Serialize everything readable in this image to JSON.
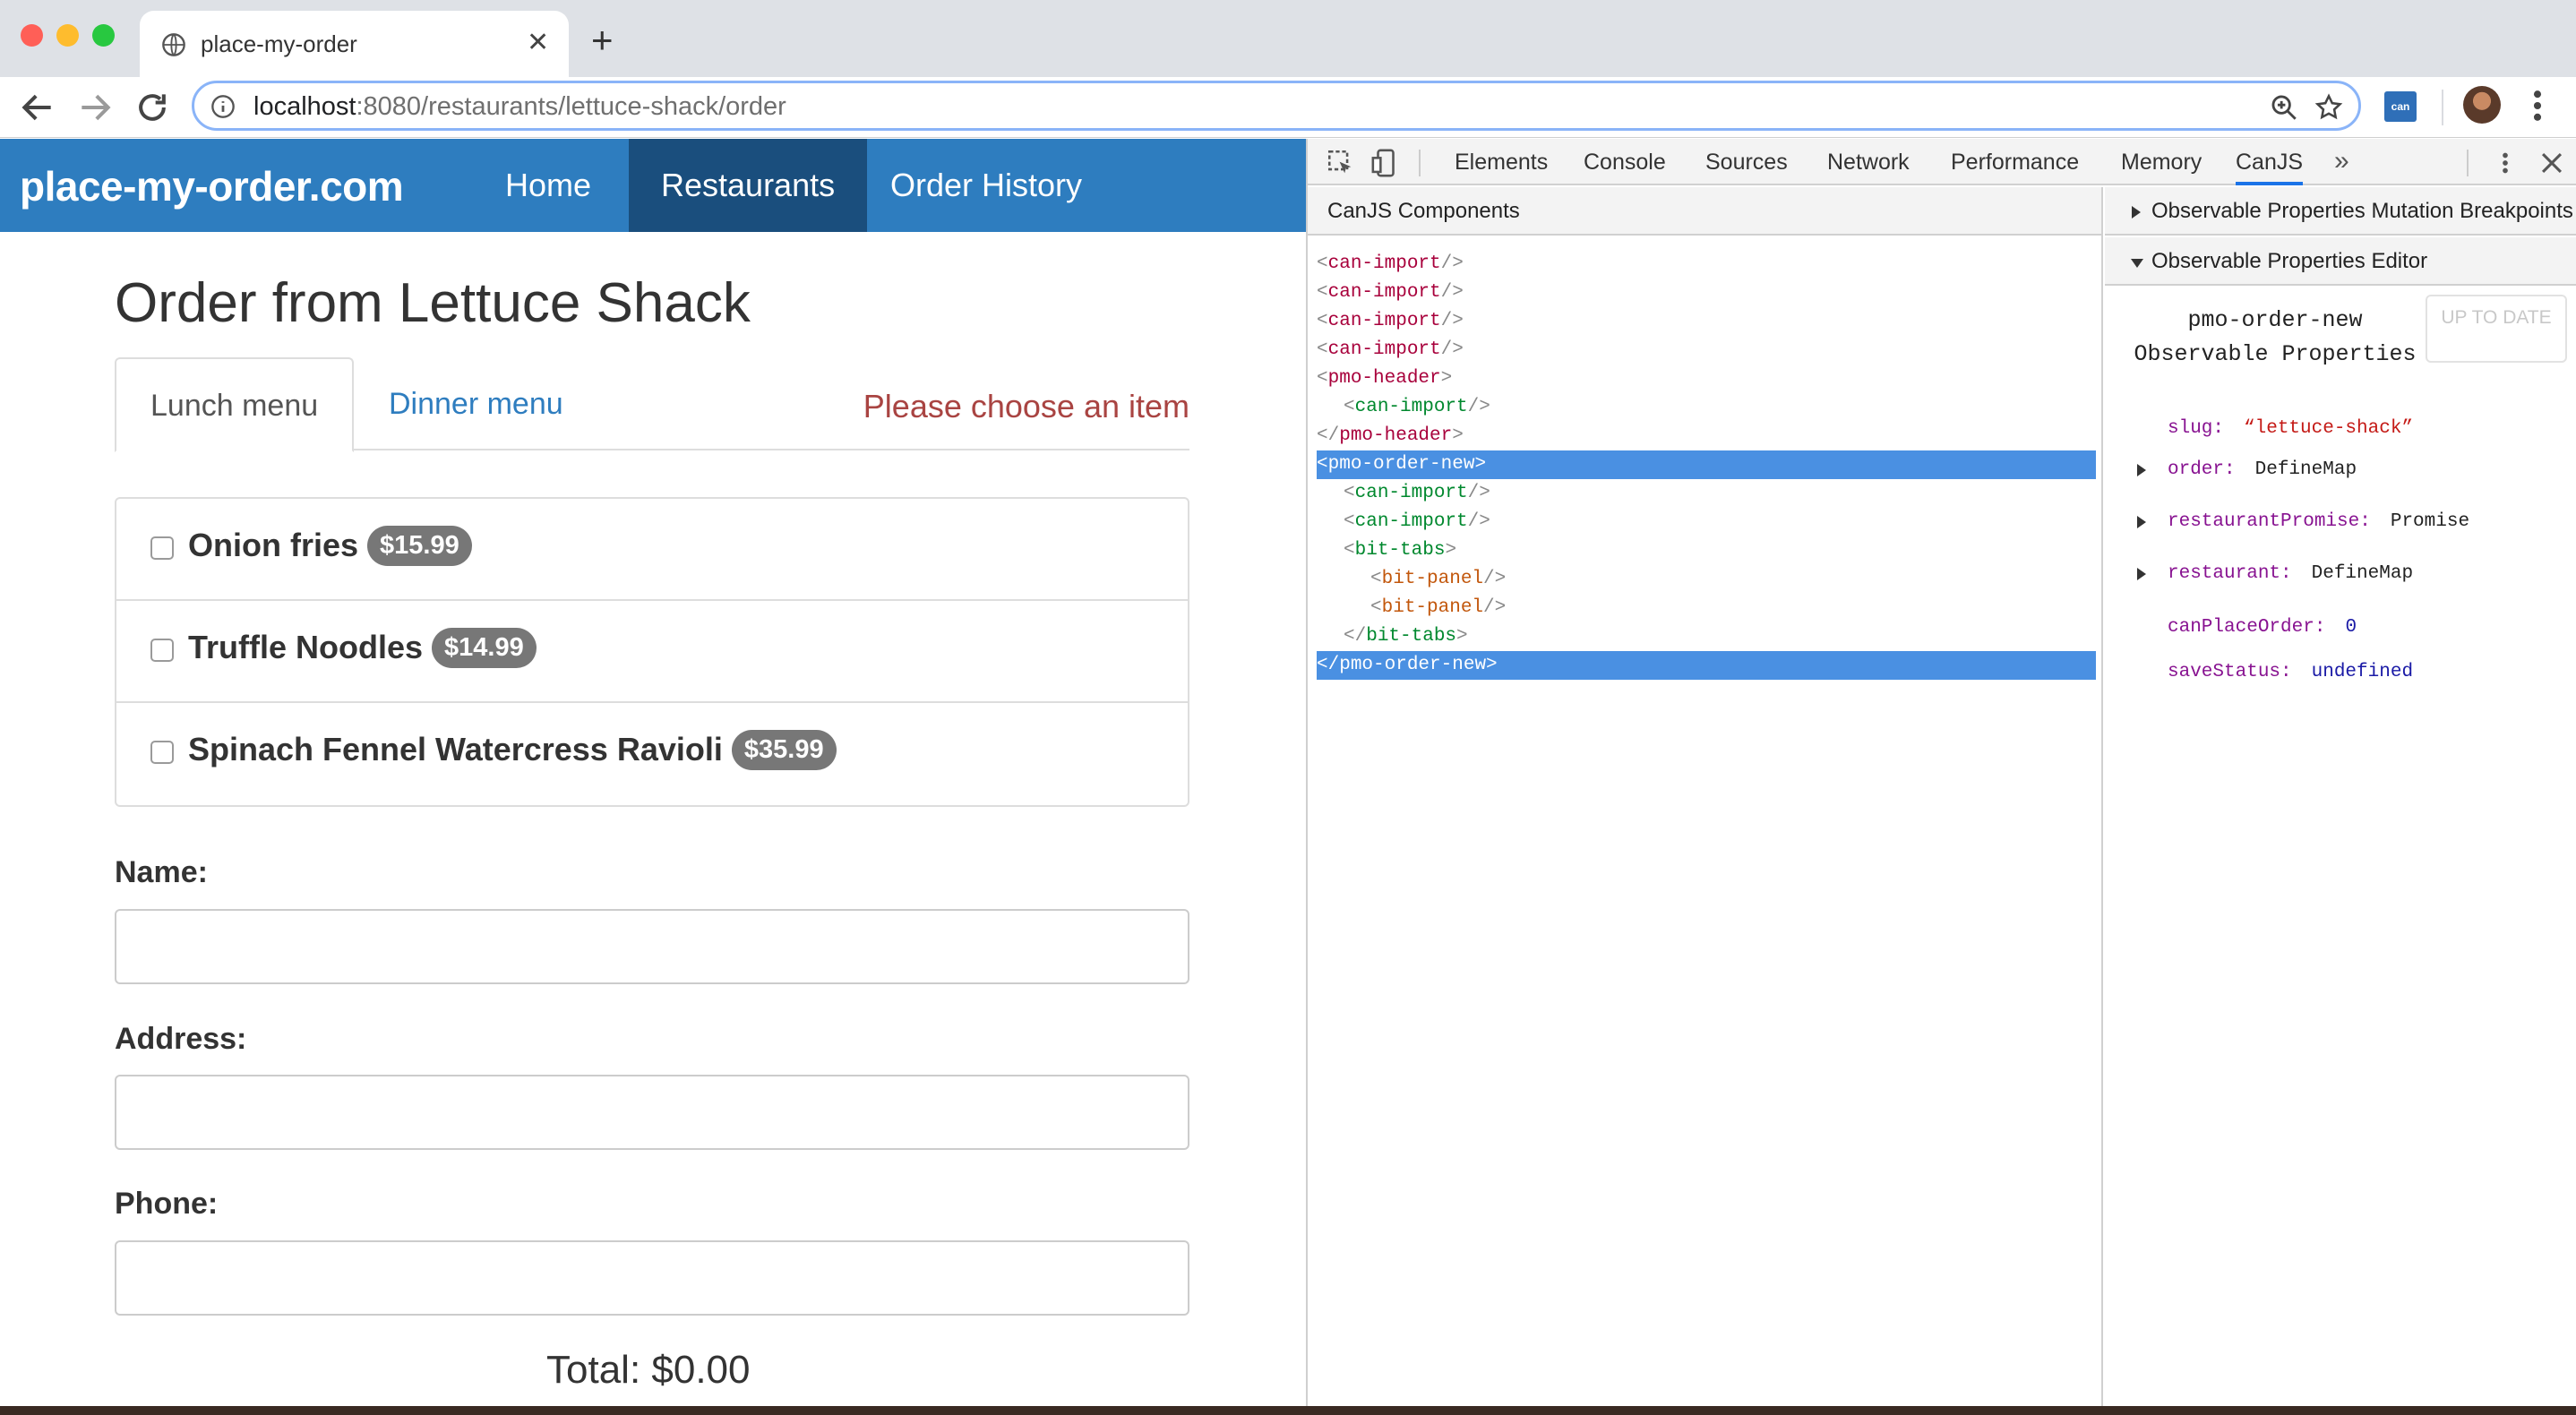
{
  "browser": {
    "tab_title": "place-my-order",
    "url_host": "localhost",
    "url_rest": ":8080/restaurants/lettuce-shack/order",
    "extension_label": "can"
  },
  "page": {
    "brand": "place-my-order.com",
    "nav": [
      "Home",
      "Restaurants",
      "Order History"
    ],
    "title": "Order from Lettuce Shack",
    "menu_tabs": [
      "Lunch menu",
      "Dinner menu"
    ],
    "choose_message": "Please choose an item",
    "items": [
      {
        "name": "Onion fries",
        "price": "$15.99"
      },
      {
        "name": "Truffle Noodles",
        "price": "$14.99"
      },
      {
        "name": "Spinach Fennel Watercress Ravioli",
        "price": "$35.99"
      }
    ],
    "labels": {
      "name": "Name:",
      "address": "Address:",
      "phone": "Phone:"
    },
    "total": "Total: $0.00"
  },
  "devtools": {
    "tabs": [
      "Elements",
      "Console",
      "Sources",
      "Network",
      "Performance",
      "Memory",
      "CanJS"
    ],
    "active_tab": "CanJS",
    "components_header": "CanJS Components",
    "tree": [
      {
        "tag": "can-import",
        "kind": "selfclose",
        "color": "red"
      },
      {
        "tag": "can-import",
        "kind": "selfclose",
        "color": "red"
      },
      {
        "tag": "can-import",
        "kind": "selfclose",
        "color": "red"
      },
      {
        "tag": "can-import",
        "kind": "selfclose",
        "color": "red"
      },
      {
        "tag": "pmo-header",
        "kind": "open",
        "color": "red"
      },
      {
        "tag": "can-import",
        "kind": "selfclose",
        "color": "green"
      },
      {
        "tag": "pmo-header",
        "kind": "close",
        "color": "red"
      },
      {
        "tag": "pmo-order-new",
        "kind": "open",
        "color": "red",
        "selected": true
      },
      {
        "tag": "can-import",
        "kind": "selfclose",
        "color": "green"
      },
      {
        "tag": "can-import",
        "kind": "selfclose",
        "color": "green"
      },
      {
        "tag": "bit-tabs",
        "kind": "open",
        "color": "green"
      },
      {
        "tag": "bit-panel",
        "kind": "selfclose",
        "color": "orange"
      },
      {
        "tag": "bit-panel",
        "kind": "selfclose",
        "color": "orange"
      },
      {
        "tag": "bit-tabs",
        "kind": "close",
        "color": "green"
      },
      {
        "tag": "pmo-order-new",
        "kind": "close",
        "color": "red",
        "selected": true
      }
    ],
    "mutation_header": "Observable Properties Mutation Breakpoints",
    "editor_header": "Observable Properties Editor",
    "editor_title_line1": "pmo-order-new",
    "editor_title_line2": "Observable Properties",
    "up_to_date": "UP TO DATE",
    "props": [
      {
        "key": "slug:",
        "value": "“lettuce-shack”",
        "type": "string",
        "expandable": false
      },
      {
        "key": "order:",
        "value": "DefineMap",
        "type": "object",
        "expandable": true
      },
      {
        "key": "restaurantPromise:",
        "value": "Promise",
        "type": "object",
        "expandable": true
      },
      {
        "key": "restaurant:",
        "value": "DefineMap",
        "type": "object",
        "expandable": true
      },
      {
        "key": "canPlaceOrder:",
        "value": "0",
        "type": "number",
        "expandable": false
      },
      {
        "key": "saveStatus:",
        "value": "undefined",
        "type": "number",
        "expandable": false
      }
    ]
  }
}
